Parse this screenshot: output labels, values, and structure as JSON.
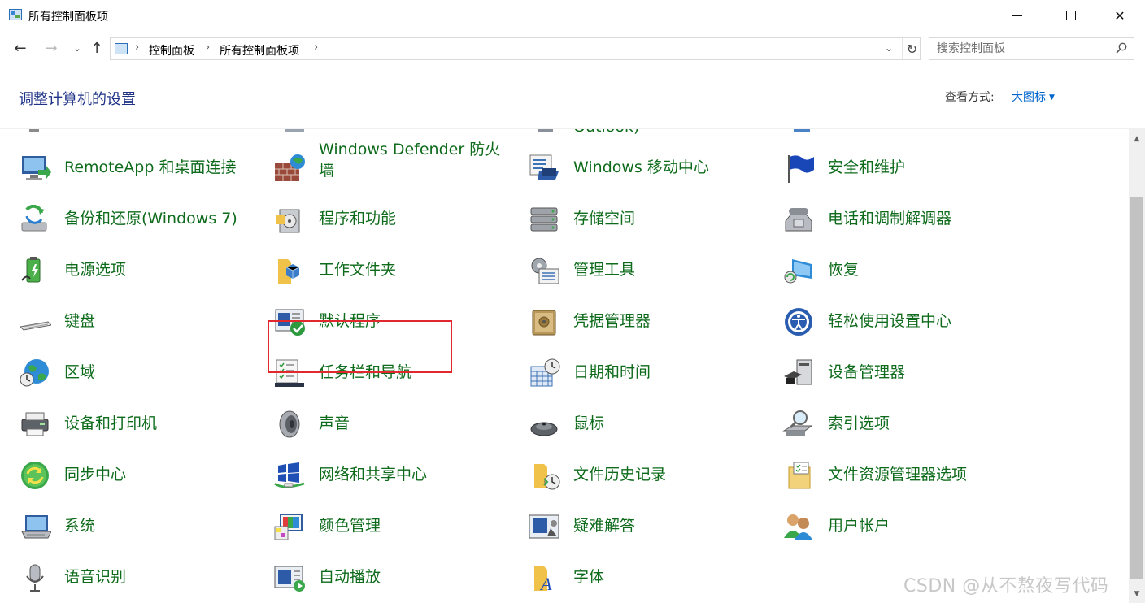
{
  "window": {
    "title": "所有控制面板项",
    "minimize_icon": "minimize-icon",
    "maximize_icon": "maximize-icon",
    "close_icon": "close-icon",
    "close_glyph": "✕"
  },
  "nav": {
    "back_glyph": "←",
    "forward_glyph": "→",
    "recent_glyph": "⌄",
    "up_glyph": "↑",
    "breadcrumb": [
      "控制面板",
      "所有控制面板项"
    ],
    "crumb_sep": "›",
    "dropdown_glyph": "⌄",
    "refresh_glyph": "↻",
    "search_placeholder": "搜索控制面板"
  },
  "header": {
    "title": "调整计算机的设置",
    "view_by_label": "查看方式:",
    "view_by_value": "大图标"
  },
  "partial_top": {
    "col3_text": "Outlook)"
  },
  "items": [
    {
      "label": "RemoteApp 和桌面连接",
      "icon": "remoteapp-icon"
    },
    {
      "label": "Windows Defender 防火墙",
      "icon": "firewall-icon"
    },
    {
      "label": "Windows 移动中心",
      "icon": "mobility-center-icon"
    },
    {
      "label": "安全和维护",
      "icon": "security-flag-icon"
    },
    {
      "label": "备份和还原(Windows 7)",
      "icon": "backup-icon"
    },
    {
      "label": "程序和功能",
      "icon": "programs-icon"
    },
    {
      "label": "存储空间",
      "icon": "storage-icon"
    },
    {
      "label": "电话和调制解调器",
      "icon": "phone-modem-icon"
    },
    {
      "label": "电源选项",
      "icon": "power-icon"
    },
    {
      "label": "工作文件夹",
      "icon": "work-folders-icon"
    },
    {
      "label": "管理工具",
      "icon": "admin-tools-icon"
    },
    {
      "label": "恢复",
      "icon": "recovery-icon"
    },
    {
      "label": "键盘",
      "icon": "keyboard-icon"
    },
    {
      "label": "默认程序",
      "icon": "default-programs-icon"
    },
    {
      "label": "凭据管理器",
      "icon": "credential-icon"
    },
    {
      "label": "轻松使用设置中心",
      "icon": "ease-of-access-icon"
    },
    {
      "label": "区域",
      "icon": "region-globe-icon"
    },
    {
      "label": "任务栏和导航",
      "icon": "taskbar-icon"
    },
    {
      "label": "日期和时间",
      "icon": "datetime-icon"
    },
    {
      "label": "设备管理器",
      "icon": "device-manager-icon"
    },
    {
      "label": "设备和打印机",
      "icon": "printer-icon"
    },
    {
      "label": "声音",
      "icon": "sound-icon"
    },
    {
      "label": "鼠标",
      "icon": "mouse-icon"
    },
    {
      "label": "索引选项",
      "icon": "indexing-icon"
    },
    {
      "label": "同步中心",
      "icon": "sync-icon"
    },
    {
      "label": "网络和共享中心",
      "icon": "network-icon"
    },
    {
      "label": "文件历史记录",
      "icon": "file-history-icon"
    },
    {
      "label": "文件资源管理器选项",
      "icon": "explorer-options-icon"
    },
    {
      "label": "系统",
      "icon": "system-icon"
    },
    {
      "label": "颜色管理",
      "icon": "color-management-icon"
    },
    {
      "label": "疑难解答",
      "icon": "troubleshoot-icon"
    },
    {
      "label": "用户帐户",
      "icon": "user-accounts-icon"
    },
    {
      "label": "语音识别",
      "icon": "microphone-icon"
    },
    {
      "label": "自动播放",
      "icon": "autoplay-icon"
    },
    {
      "label": "字体",
      "icon": "fonts-icon"
    }
  ],
  "scrollbar": {
    "up_glyph": "▲",
    "down_glyph": "▼"
  },
  "watermark": "CSDN @从不熬夜写代码",
  "colors": {
    "link_green": "#0e6b1b",
    "heading_blue": "#1e3287",
    "view_blue": "#0066cc",
    "highlight_red": "#e0282e"
  }
}
